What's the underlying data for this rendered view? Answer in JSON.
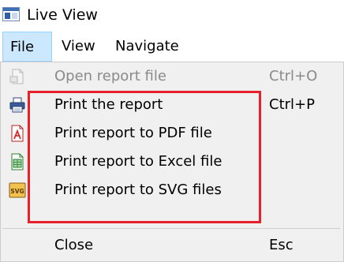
{
  "window": {
    "title": "Live View",
    "app_icon": "window-icon"
  },
  "menubar": {
    "items": [
      {
        "label": "File",
        "active": true
      },
      {
        "label": "View",
        "active": false
      },
      {
        "label": "Navigate",
        "active": false
      }
    ]
  },
  "file_menu": {
    "items": [
      {
        "label": "Open report file",
        "shortcut": "Ctrl+O",
        "icon": "open-file-icon",
        "enabled": false
      },
      {
        "label": "Print the report",
        "shortcut": "Ctrl+P",
        "icon": "printer-icon",
        "enabled": true
      },
      {
        "label": "Print report to PDF file",
        "shortcut": "",
        "icon": "pdf-icon",
        "enabled": true
      },
      {
        "label": "Print report to Excel file",
        "shortcut": "",
        "icon": "excel-icon",
        "enabled": true
      },
      {
        "label": "Print report to SVG files",
        "shortcut": "",
        "icon": "svg-icon",
        "enabled": true
      },
      {
        "label": "Close",
        "shortcut": "Esc",
        "icon": "",
        "enabled": true
      }
    ],
    "svg_icon_text": "SVG"
  },
  "colors": {
    "menu_active_bg": "#cce8ff",
    "menu_active_border": "#99d1ff",
    "dropdown_bg": "#f0f0f0",
    "highlight_border": "#e8202a",
    "disabled_text": "#8a8a8a"
  }
}
